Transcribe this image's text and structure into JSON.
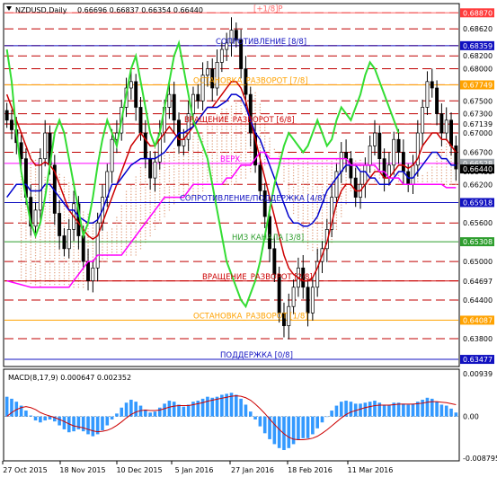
{
  "chart_data": {
    "type": "candlestick",
    "symbol_header": "NZDUSD,Daily",
    "ohlc_header": "0.66696 0.66837 0.66354 0.66440",
    "price_axis": {
      "ylim": [
        0.6338,
        0.69
      ],
      "labels": [
        "0.68870",
        "0.68620",
        "0.68359",
        "0.68200",
        "0.68000",
        "0.67749",
        "0.67500",
        "0.67300",
        "0.67139",
        "0.67000",
        "0.66700",
        "0.66528",
        "0.66400",
        "0.66200",
        "0.65918",
        "0.65600",
        "0.65308",
        "0.65000",
        "0.64697",
        "0.64400",
        "0.64087",
        "0.63800",
        "0.63477"
      ],
      "badges": [
        {
          "value": "0.68870",
          "color": "#ff3b3b"
        },
        {
          "value": "0.68359",
          "color": "#1010c0"
        },
        {
          "value": "0.67749",
          "color": "#ffa200"
        },
        {
          "value": "0.66528",
          "color": "#9aa0a6"
        },
        {
          "value": "0.66440",
          "color": "#000000"
        },
        {
          "value": "0.65918",
          "color": "#1010c0"
        },
        {
          "value": "0.65308",
          "color": "#2e9e2e"
        },
        {
          "value": "0.64087",
          "color": "#ffa200"
        },
        {
          "value": "0.63477",
          "color": "#1010c0"
        }
      ]
    },
    "murray_levels": [
      {
        "price": 0.6887,
        "label": "[+1/8]P",
        "color": "#ff6666"
      },
      {
        "price": 0.68359,
        "label": "СОПРОТИВЛЕНИЕ [8/8]",
        "color": "#1010c0"
      },
      {
        "price": 0.67749,
        "label": "ОСТАНОВКА_РАЗВОРОТ [7/8]",
        "color": "#ffa200"
      },
      {
        "price": 0.67139,
        "label": "ВРАЩЕНИЕ_РАЗВОРОТ [6/8]",
        "color": "#cc0000"
      },
      {
        "price": 0.66528,
        "label": "ВЕРХ",
        "color": "#ff00ff"
      },
      {
        "price": 0.65918,
        "label": "СОПРОТИВЛЕНИЕ/ПОДДЕРЖКА [4/8]",
        "color": "#1010c0"
      },
      {
        "price": 0.65308,
        "label": "НИЗ КАНАЛА [3/8]",
        "color": "#2e9e2e"
      },
      {
        "price": 0.64697,
        "label": "ВРАЩЕНИЕ_РАЗВОРОТ [2/8]",
        "color": "#cc0000"
      },
      {
        "price": 0.64087,
        "label": "ОСТАНОВКА_РАЗВОРОТ [1/8]",
        "color": "#ffa200"
      },
      {
        "price": 0.63477,
        "label": "ПОДДЕРЖКА [0/8]",
        "color": "#1010c0"
      }
    ],
    "dashed_levels": [
      0.6887,
      0.6862,
      0.6836,
      0.682,
      0.68,
      0.6775,
      0.675,
      0.673,
      0.6714,
      0.67,
      0.667,
      0.662,
      0.656,
      0.65,
      0.647,
      0.644,
      0.638
    ],
    "close": [
      0.672,
      0.6705,
      0.6685,
      0.666,
      0.66,
      0.6555,
      0.658,
      0.666,
      0.67,
      0.665,
      0.6575,
      0.654,
      0.652,
      0.655,
      0.659,
      0.654,
      0.65,
      0.647,
      0.649,
      0.656,
      0.66,
      0.664,
      0.669,
      0.67,
      0.674,
      0.677,
      0.678,
      0.674,
      0.67,
      0.666,
      0.663,
      0.6655,
      0.67,
      0.674,
      0.676,
      0.672,
      0.668,
      0.669,
      0.673,
      0.676,
      0.675,
      0.679,
      0.68,
      0.677,
      0.681,
      0.683,
      0.684,
      0.686,
      0.6845,
      0.68,
      0.676,
      0.67,
      0.665,
      0.661,
      0.657,
      0.652,
      0.648,
      0.642,
      0.64,
      0.643,
      0.646,
      0.649,
      0.646,
      0.642,
      0.646,
      0.65,
      0.652,
      0.655,
      0.66,
      0.664,
      0.667,
      0.666,
      0.663,
      0.66,
      0.662,
      0.665,
      0.668,
      0.67,
      0.666,
      0.663,
      0.665,
      0.669,
      0.667,
      0.664,
      0.662,
      0.665,
      0.67,
      0.674,
      0.678,
      0.677,
      0.673,
      0.67,
      0.672,
      0.668,
      0.6644
    ],
    "lines": [
      {
        "name": "",
        "color": "#cc0000",
        "values": [
          0.676,
          0.674,
          0.672,
          0.67,
          0.668,
          0.666,
          0.665,
          0.665,
          0.6655,
          0.665,
          0.664,
          0.662,
          0.66,
          0.658,
          0.657,
          0.656,
          0.655,
          0.654,
          0.6535,
          0.654,
          0.656,
          0.658,
          0.66,
          0.662,
          0.664,
          0.666,
          0.668,
          0.669,
          0.67,
          0.669,
          0.668,
          0.668,
          0.669,
          0.67,
          0.671,
          0.67,
          0.669,
          0.669,
          0.67,
          0.671,
          0.672,
          0.673,
          0.674,
          0.674,
          0.675,
          0.676,
          0.677,
          0.678,
          0.678,
          0.677,
          0.675,
          0.672,
          0.669,
          0.666,
          0.663,
          0.66,
          0.657,
          0.654,
          0.651,
          0.649,
          0.648,
          0.6475,
          0.647,
          0.647,
          0.6475,
          0.649,
          0.651,
          0.653,
          0.656,
          0.659,
          0.661,
          0.662,
          0.662,
          0.661,
          0.661,
          0.662,
          0.663,
          0.664,
          0.664,
          0.663,
          0.663,
          0.664,
          0.665,
          0.665,
          0.6645,
          0.665,
          0.666,
          0.668,
          0.669,
          0.67,
          0.67,
          0.669,
          0.669,
          0.668,
          0.667
        ]
      },
      {
        "name": "",
        "color": "#0000cc",
        "values": [
          0.66,
          0.661,
          0.662,
          0.662,
          0.662,
          0.661,
          0.661,
          0.661,
          0.662,
          0.662,
          0.661,
          0.66,
          0.659,
          0.658,
          0.658,
          0.657,
          0.6565,
          0.656,
          0.656,
          0.6565,
          0.658,
          0.66,
          0.662,
          0.662,
          0.663,
          0.664,
          0.665,
          0.6655,
          0.666,
          0.666,
          0.666,
          0.666,
          0.6665,
          0.667,
          0.668,
          0.669,
          0.67,
          0.67,
          0.6705,
          0.671,
          0.672,
          0.673,
          0.674,
          0.674,
          0.674,
          0.6745,
          0.675,
          0.676,
          0.676,
          0.6755,
          0.674,
          0.672,
          0.67,
          0.669,
          0.667,
          0.665,
          0.663,
          0.661,
          0.659,
          0.657,
          0.656,
          0.656,
          0.6555,
          0.6555,
          0.656,
          0.657,
          0.659,
          0.661,
          0.662,
          0.663,
          0.664,
          0.665,
          0.665,
          0.665,
          0.664,
          0.664,
          0.663,
          0.663,
          0.662,
          0.662,
          0.662,
          0.663,
          0.664,
          0.664,
          0.663,
          0.663,
          0.664,
          0.665,
          0.666,
          0.667,
          0.667,
          0.666,
          0.666,
          0.665,
          0.665
        ]
      },
      {
        "name": "",
        "color": "#ff00ff",
        "values": [
          0.647,
          0.6468,
          0.6466,
          0.6464,
          0.6462,
          0.646,
          0.646,
          0.646,
          0.646,
          0.646,
          0.646,
          0.646,
          0.646,
          0.646,
          0.647,
          0.648,
          0.649,
          0.65,
          0.65,
          0.651,
          0.651,
          0.651,
          0.651,
          0.651,
          0.651,
          0.652,
          0.653,
          0.654,
          0.655,
          0.656,
          0.657,
          0.658,
          0.659,
          0.66,
          0.66,
          0.66,
          0.66,
          0.66,
          0.661,
          0.662,
          0.662,
          0.662,
          0.662,
          0.662,
          0.662,
          0.662,
          0.663,
          0.663,
          0.664,
          0.665,
          0.665,
          0.665,
          0.666,
          0.667,
          0.667,
          0.666,
          0.666,
          0.666,
          0.666,
          0.666,
          0.666,
          0.666,
          0.666,
          0.666,
          0.666,
          0.666,
          0.666,
          0.666,
          0.666,
          0.666,
          0.666,
          0.666,
          0.665,
          0.665,
          0.665,
          0.665,
          0.665,
          0.665,
          0.664,
          0.664,
          0.663,
          0.663,
          0.663,
          0.662,
          0.662,
          0.662,
          0.662,
          0.662,
          0.662,
          0.662,
          0.662,
          0.662,
          0.6615,
          0.6615,
          0.6615
        ]
      },
      {
        "name": "",
        "color": "#33dd33",
        "values": [
          0.662,
          0.665,
          0.67,
          0.675,
          0.68,
          0.682,
          0.678,
          0.672,
          0.67,
          0.676,
          0.684,
          0.686,
          0.683,
          0.678,
          0.67,
          0.664,
          0.66,
          0.656,
          0.654,
          0.656,
          0.66,
          0.665,
          0.67,
          0.672,
          0.67,
          0.666,
          0.662,
          0.658,
          0.654,
          0.656,
          0.66,
          0.665,
          0.669,
          0.672,
          0.67,
          0.668,
          0.672,
          0.676,
          0.68,
          0.682,
          0.678,
          0.674,
          0.67,
          0.668,
          0.67,
          0.674,
          0.678,
          0.682,
          0.684,
          0.68,
          0.676,
          0.672,
          0.67,
          0.668,
          0.666,
          0.662,
          0.658,
          0.654,
          0.65,
          0.648,
          0.646,
          0.644,
          0.643,
          0.645,
          0.647,
          0.65,
          0.654,
          0.658,
          0.662,
          0.665,
          0.668,
          0.67,
          0.669,
          0.668,
          0.667,
          0.668,
          0.67,
          0.672,
          0.67,
          0.668,
          0.669,
          0.672,
          0.674,
          0.673,
          0.672,
          0.674,
          0.676,
          0.679,
          0.681,
          0.68,
          0.678,
          0.676,
          0.674,
          0.672,
          0.67
        ]
      }
    ],
    "macd": {
      "label": "MACD(8,17,9) 0.000647 0.002352",
      "axis_labels": [
        "0.00939",
        "0.00",
        "-0.008795"
      ],
      "ylim": [
        -0.0088,
        0.0094
      ],
      "histogram": [
        0.004,
        0.0036,
        0.003,
        0.0022,
        0.0012,
        0.0002,
        -0.0008,
        -0.0012,
        -0.0008,
        -0.0006,
        -0.001,
        -0.0018,
        -0.0026,
        -0.0032,
        -0.003,
        -0.0026,
        -0.003,
        -0.0036,
        -0.004,
        -0.0036,
        -0.0028,
        -0.0018,
        -0.0006,
        0.0006,
        0.0018,
        0.0028,
        0.0034,
        0.003,
        0.0022,
        0.0014,
        0.0008,
        0.001,
        0.0018,
        0.0026,
        0.0032,
        0.003,
        0.0024,
        0.002,
        0.0024,
        0.003,
        0.0032,
        0.0036,
        0.004,
        0.0038,
        0.004,
        0.0044,
        0.0046,
        0.0048,
        0.0044,
        0.0036,
        0.0024,
        0.001,
        -0.0006,
        -0.002,
        -0.0034,
        -0.0046,
        -0.0056,
        -0.0064,
        -0.0068,
        -0.0064,
        -0.0056,
        -0.0048,
        -0.0044,
        -0.0044,
        -0.0036,
        -0.0024,
        -0.0012,
        0.0,
        0.0012,
        0.0022,
        0.003,
        0.0032,
        0.003,
        0.0026,
        0.0026,
        0.0028,
        0.003,
        0.0032,
        0.0028,
        0.0024,
        0.0024,
        0.0028,
        0.0028,
        0.0026,
        0.0024,
        0.0026,
        0.003,
        0.0034,
        0.0038,
        0.0036,
        0.003,
        0.0024,
        0.0022,
        0.0016,
        0.0008
      ],
      "signal": [
        0.0,
        0.0008,
        0.0014,
        0.0018,
        0.002,
        0.0018,
        0.0014,
        0.0008,
        0.0004,
        0.0001,
        -0.0002,
        -0.0006,
        -0.001,
        -0.0015,
        -0.0019,
        -0.0021,
        -0.0023,
        -0.0026,
        -0.0029,
        -0.0031,
        -0.003,
        -0.0028,
        -0.0024,
        -0.0018,
        -0.0011,
        -0.0003,
        0.0004,
        0.0009,
        0.0012,
        0.0013,
        0.0012,
        0.0012,
        0.0013,
        0.0016,
        0.0019,
        0.0021,
        0.0022,
        0.0022,
        0.0022,
        0.0024,
        0.0026,
        0.0028,
        0.0031,
        0.0033,
        0.0035,
        0.0037,
        0.0039,
        0.0041,
        0.0042,
        0.0041,
        0.0038,
        0.0033,
        0.0025,
        0.0016,
        0.0006,
        -0.0005,
        -0.0016,
        -0.0026,
        -0.0035,
        -0.0042,
        -0.0046,
        -0.0047,
        -0.0047,
        -0.0046,
        -0.0044,
        -0.004,
        -0.0034,
        -0.0027,
        -0.0019,
        -0.0011,
        -0.0003,
        0.0004,
        0.0009,
        0.0012,
        0.0015,
        0.0018,
        0.002,
        0.0022,
        0.0023,
        0.0023,
        0.0023,
        0.0024,
        0.0025,
        0.0025,
        0.0025,
        0.0025,
        0.0026,
        0.0027,
        0.0029,
        0.003,
        0.003,
        0.0029,
        0.0028,
        0.0026,
        0.0024
      ]
    },
    "x_labels": [
      "27 Oct 2015",
      "18 Nov 2015",
      "10 Dec 2015",
      "5 Jan 2016",
      "27 Jan 2016",
      "18 Feb 2016",
      "11 Mar 2016"
    ]
  }
}
